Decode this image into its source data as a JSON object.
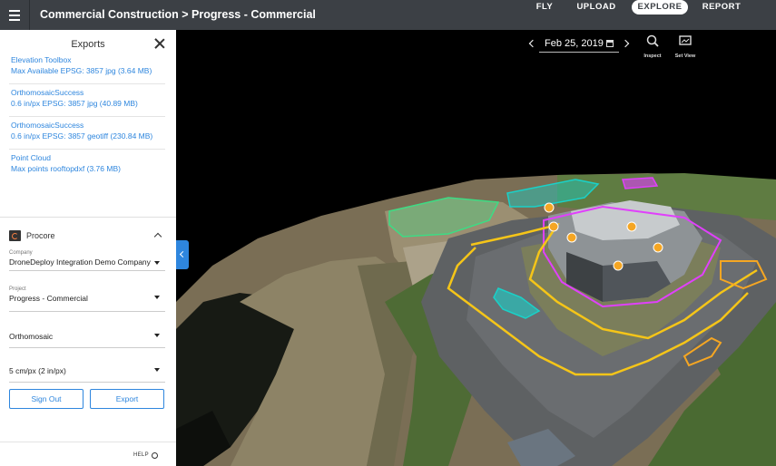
{
  "header": {
    "title": "Commercial Construction > Progress - Commercial",
    "nav": [
      "FLY",
      "UPLOAD",
      "EXPLORE",
      "REPORT"
    ],
    "active_nav": "EXPLORE"
  },
  "sidebar": {
    "title": "Exports",
    "exports": [
      {
        "name": "Elevation Toolbox",
        "details": "Max Available  EPSG:  3857  jpg   (3.64 MB)"
      },
      {
        "name": "OrthomosaicSuccess",
        "details": "0.6 in/px    EPSG:  3857    jpg      (40.89 MB)"
      },
      {
        "name": "OrthomosaicSuccess",
        "details": "0.6 in/px  EPSG:  3857  geotiff   (230.84 MB)"
      },
      {
        "name": "Point Cloud",
        "details": "Max points            rooftopdxf                   (3.76 MB)"
      }
    ],
    "procore": {
      "name": "Procore",
      "company_label": "Company",
      "company_value": "DroneDeploy Integration Demo Company",
      "project_label": "Project",
      "project_value": "Progress - Commercial",
      "layer_value": "Orthomosaic",
      "resolution_value": "5 cm/px (2 in/px)",
      "sign_out": "Sign Out",
      "export": "Export"
    },
    "help": "HELP"
  },
  "map": {
    "date": "Feb 25, 2019",
    "tools": [
      {
        "label": "Inspect",
        "icon": "magnifier-icon"
      },
      {
        "label": "Set View",
        "icon": "set-view-icon"
      }
    ]
  },
  "colors": {
    "accent": "#2e86de",
    "topbar": "#3c4045",
    "annotation_yellow": "#f5c518",
    "annotation_magenta": "#e040fb",
    "annotation_green": "#3ddc84",
    "annotation_teal": "#1ad1c8",
    "annotation_orange": "#f5a623"
  }
}
